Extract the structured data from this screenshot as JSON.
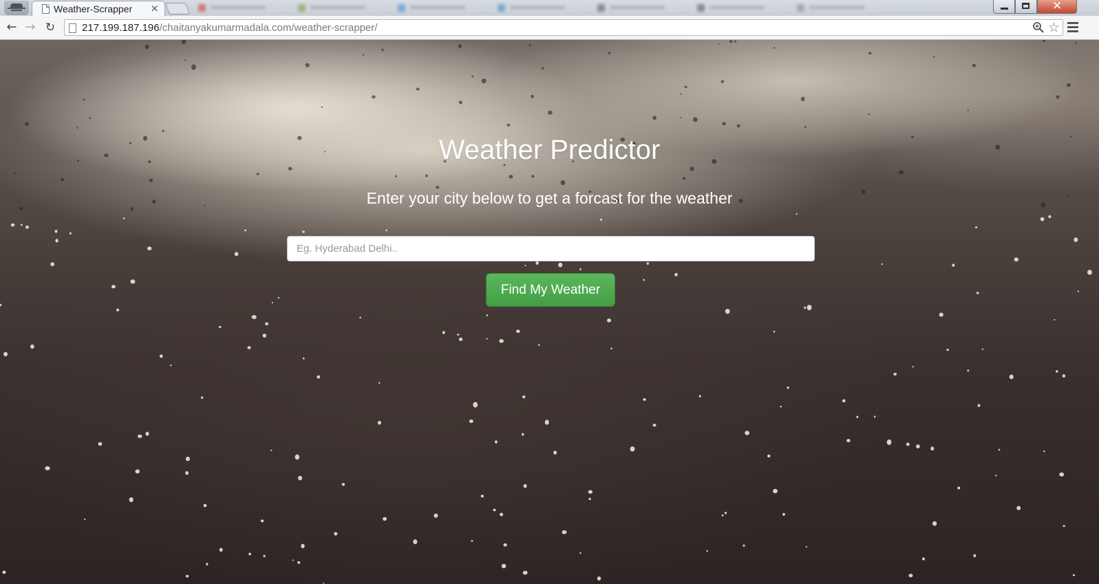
{
  "browser": {
    "active_tab": {
      "title": "Weather-Scrapper",
      "close_glyph": "×",
      "icon": "page-icon"
    },
    "address_bar": {
      "url_host": "217.199.187.196",
      "url_path": "/chaitanyakumarmadala.com/weather-scrapper/"
    },
    "nav": {
      "back_icon": "back-arrow-icon",
      "forward_icon": "forward-arrow-icon",
      "reload_icon": "reload-icon"
    }
  },
  "page": {
    "title": "Weather Predictor",
    "subtitle": "Enter your city below to get a forcast for the weather",
    "city_input": {
      "placeholder": "Eg. Hyderabad Delhi..",
      "value": ""
    },
    "submit_label": "Find My Weather"
  },
  "colors": {
    "button_green": "#5cb85c",
    "button_border": "#398439",
    "heading_text": "#ffffff"
  }
}
